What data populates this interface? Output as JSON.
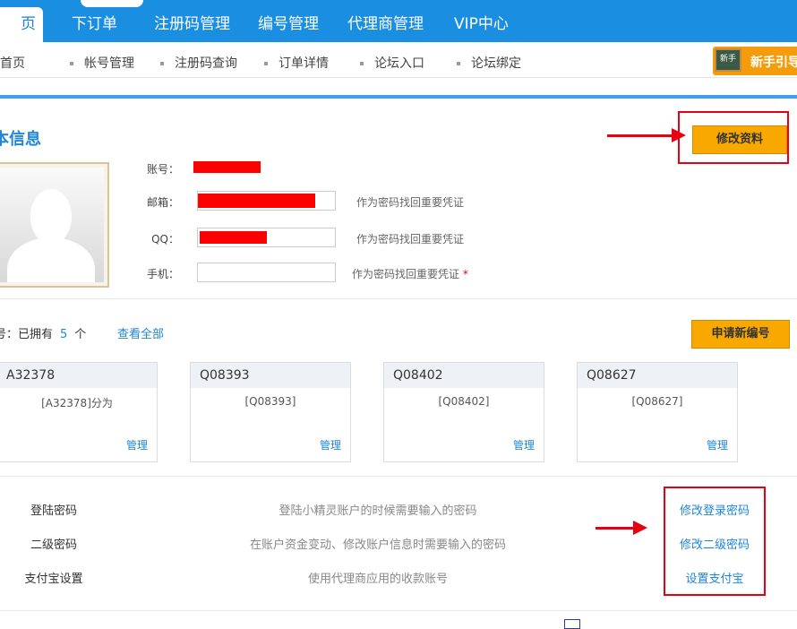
{
  "topnav": {
    "active_tab": "页",
    "tabs": [
      "下订单",
      "注册码管理",
      "编号管理",
      "代理商管理",
      "VIP中心"
    ]
  },
  "subnav": {
    "items": [
      "首页",
      "帐号管理",
      "注册码查询",
      "订单详情",
      "论坛入口",
      "论坛绑定"
    ],
    "guide_badge": "新手",
    "guide_text": "新手引导"
  },
  "profile": {
    "title": "本信息",
    "edit_button": "修改资料",
    "fields": [
      {
        "label": "账号：",
        "hint": ""
      },
      {
        "label": "邮箱：",
        "hint": "作为密码找回重要凭证"
      },
      {
        "label": "QQ：",
        "hint": "作为密码找回重要凭证"
      },
      {
        "label": "手机：",
        "hint": "作为密码找回重要凭证",
        "required_mark": "*"
      }
    ]
  },
  "numbers": {
    "prefix": "号：已拥有",
    "count": "5",
    "unit": "个",
    "view_all": "查看全部",
    "apply_button": "申请新编号",
    "cards": [
      {
        "id": "A32378",
        "desc": "[A32378]分为",
        "manage": "管理"
      },
      {
        "id": "Q08393",
        "desc": "[Q08393]",
        "manage": "管理"
      },
      {
        "id": "Q08402",
        "desc": "[Q08402]",
        "manage": "管理"
      },
      {
        "id": "Q08627",
        "desc": "[Q08627]",
        "manage": "管理"
      }
    ]
  },
  "passwords": [
    {
      "label": "登陆密码",
      "desc": "登陆小精灵账户的时候需要输入的密码",
      "action": "修改登录密码"
    },
    {
      "label": "二级密码",
      "desc": "在账户资金变动、修改账户信息时需要输入的密码",
      "action": "修改二级密码"
    },
    {
      "label": "支付宝设置",
      "desc": "使用代理商应用的收款账号",
      "action": "设置支付宝"
    }
  ],
  "colors": {
    "brand_blue": "#1a8ee0",
    "accent_orange": "#f9a800",
    "annotation_red": "#e60012"
  }
}
